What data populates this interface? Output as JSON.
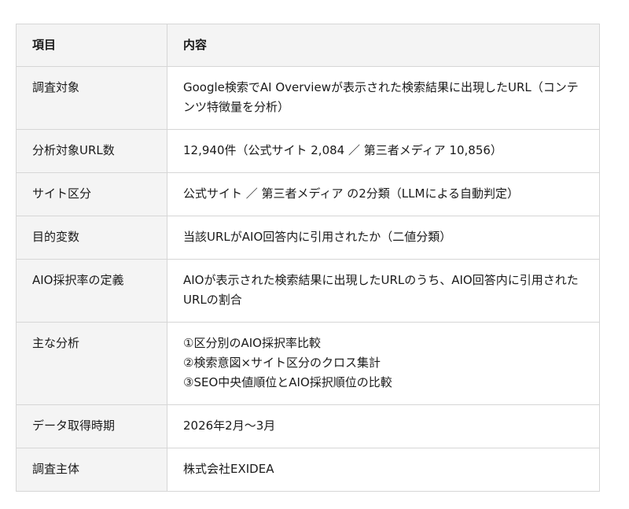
{
  "table": {
    "headers": [
      "項目",
      "内容"
    ],
    "rows": [
      {
        "label": "調査対象",
        "lines": [
          "Google検索でAI Overviewが表示された検索結果に出現したURL（コンテンツ特徴量を分析）"
        ]
      },
      {
        "label": "分析対象URL数",
        "lines": [
          "12,940件（公式サイト 2,084 ／ 第三者メディア 10,856）"
        ]
      },
      {
        "label": "サイト区分",
        "lines": [
          "公式サイト ／ 第三者メディア の2分類（LLMによる自動判定）"
        ]
      },
      {
        "label": "目的変数",
        "lines": [
          "当該URLがAIO回答内に引用されたか（二値分類）"
        ]
      },
      {
        "label": "AIO採択率の定義",
        "lines": [
          "AIOが表示された検索結果に出現したURLのうち、AIO回答内に引用されたURLの割合"
        ]
      },
      {
        "label": "主な分析",
        "lines": [
          "①区分別のAIO採択率比較",
          "②検索意図×サイト区分のクロス集計",
          "③SEO中央値順位とAIO採択順位の比較"
        ]
      },
      {
        "label": "データ取得時期",
        "lines": [
          "2026年2月〜3月"
        ]
      },
      {
        "label": "調査主体",
        "lines": [
          "株式会社EXIDEA"
        ]
      }
    ]
  }
}
